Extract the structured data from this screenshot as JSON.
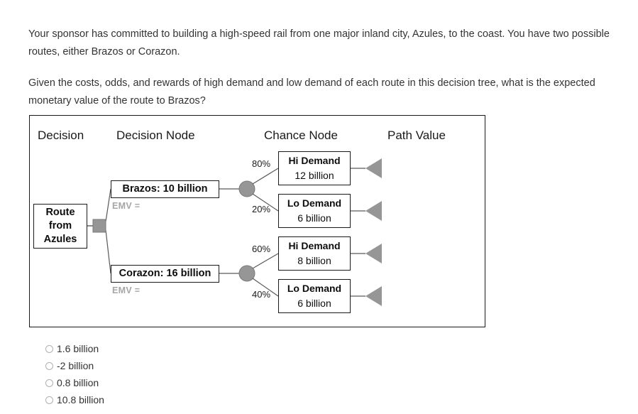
{
  "prompt": {
    "paragraph1": "Your sponsor has committed to building a high-speed rail from one major inland city, Azules, to the coast. You have two possible routes, either Brazos or Corazon.",
    "paragraph2": "Given the costs, odds, and rewards of high demand and low demand of each route in this decision tree, what is the expected monetary value of the route to Brazos?"
  },
  "diagram": {
    "headers": {
      "decision": "Decision",
      "decision_node": "Decision Node",
      "chance_node": "Chance Node",
      "path_value": "Path Value"
    },
    "root": {
      "line1": "Route",
      "line2": "from",
      "line3": "Azules"
    },
    "branches": [
      {
        "label": "Brazos: 10 billion",
        "emv": "EMV =",
        "outcomes": [
          {
            "probability": "80%",
            "title": "Hi Demand",
            "value": "12 billion"
          },
          {
            "probability": "20%",
            "title": "Lo Demand",
            "value": "6 billion"
          }
        ]
      },
      {
        "label": "Corazon: 16 billion",
        "emv": "EMV =",
        "outcomes": [
          {
            "probability": "60%",
            "title": "Hi Demand",
            "value": "8 billion"
          },
          {
            "probability": "40%",
            "title": "Lo Demand",
            "value": "6 billion"
          }
        ]
      }
    ],
    "colors": {
      "node_gray": "#969696",
      "line_gray": "#595959",
      "border_black": "#1a1a1a",
      "emv_gray": "#a6a6a6"
    }
  },
  "options": [
    {
      "label": "1.6 billion"
    },
    {
      "label": "-2 billion"
    },
    {
      "label": "0.8 billion"
    },
    {
      "label": "10.8 billion"
    }
  ]
}
